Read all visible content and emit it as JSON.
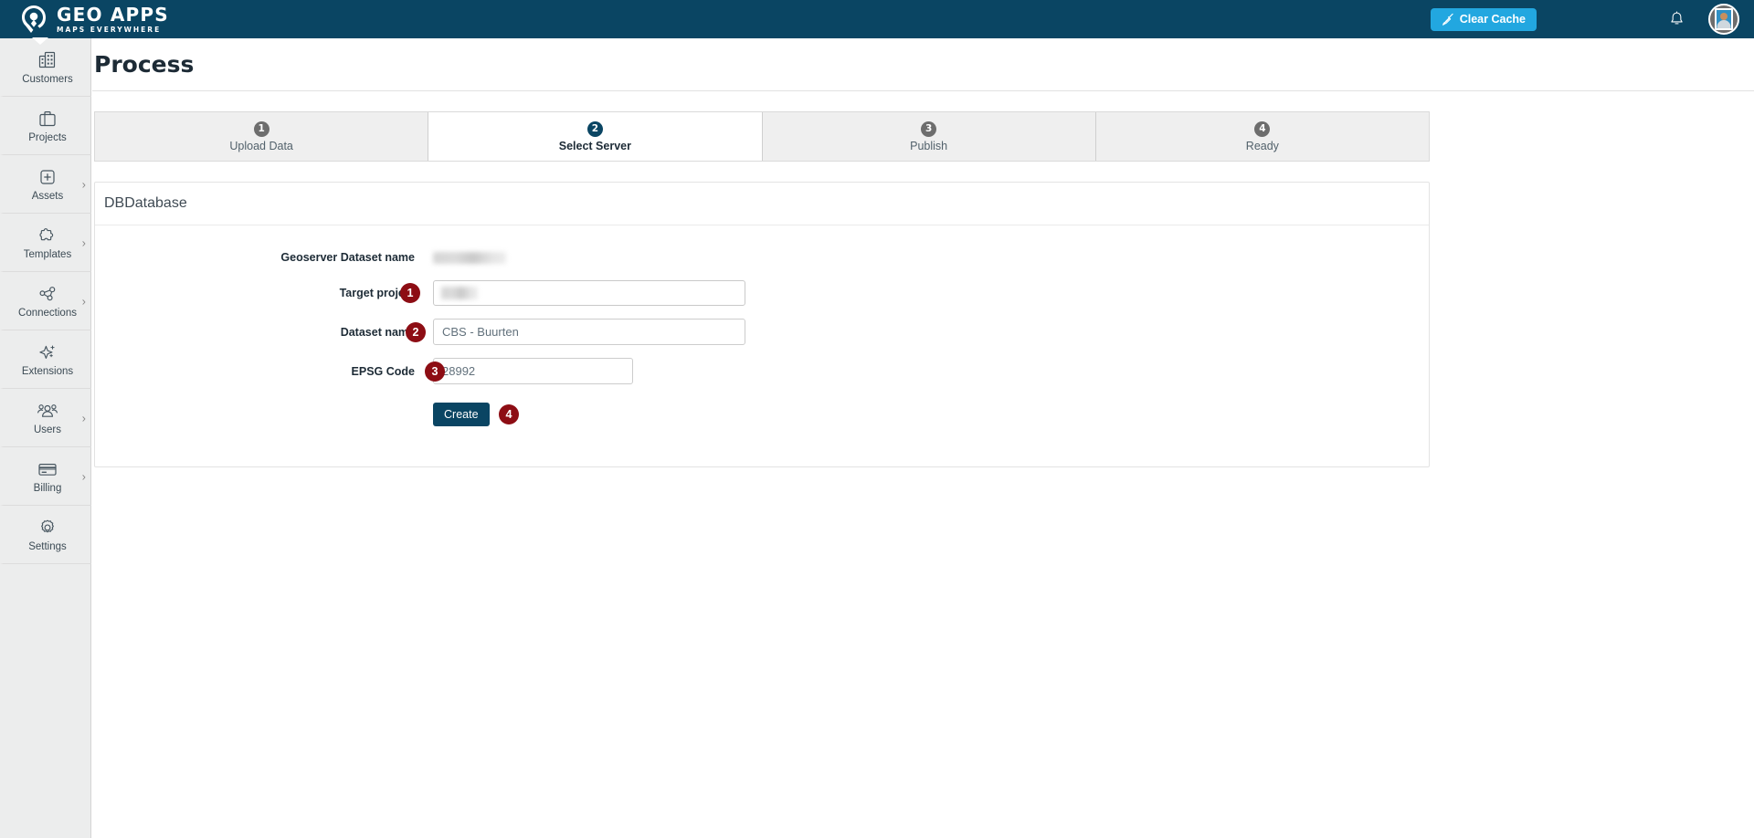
{
  "brand": {
    "title": "GEO APPS",
    "subtitle": "MAPS EVERYWHERE",
    "logo_icon": "map-pin-location-icon"
  },
  "topbar": {
    "clear_cache_label": "Clear Cache",
    "clear_cache_icon": "broom-icon",
    "clear_cache_color": "#22a7e0",
    "notifications_icon": "bell-icon",
    "avatar_icon": "user-photo-avatar",
    "background_color": "#0a4563"
  },
  "sidebar": {
    "items": [
      {
        "label": "Customers",
        "icon": "buildings-icon",
        "chevron": false
      },
      {
        "label": "Projects",
        "icon": "briefcase-icon",
        "chevron": false
      },
      {
        "label": "Assets",
        "icon": "plus-square-icon",
        "chevron": true
      },
      {
        "label": "Templates",
        "icon": "puzzle-icon",
        "chevron": true
      },
      {
        "label": "Connections",
        "icon": "share-nodes-icon",
        "chevron": true
      },
      {
        "label": "Extensions",
        "icon": "sparkle-icon",
        "chevron": false
      },
      {
        "label": "Users",
        "icon": "users-group-icon",
        "chevron": true
      },
      {
        "label": "Billing",
        "icon": "credit-card-icon",
        "chevron": true
      },
      {
        "label": "Settings",
        "icon": "gear-icon",
        "chevron": false
      }
    ],
    "chevron_glyph": "›"
  },
  "page": {
    "title": "Process"
  },
  "stepper": {
    "steps": [
      {
        "num": "1",
        "label": "Upload Data",
        "active": false
      },
      {
        "num": "2",
        "label": "Select Server",
        "active": true
      },
      {
        "num": "3",
        "label": "Publish",
        "active": false
      },
      {
        "num": "4",
        "label": "Ready",
        "active": false
      }
    ],
    "active_color": "#0a4563",
    "inactive_color": "#6d6d6d"
  },
  "card": {
    "title": "DBDatabase",
    "fields": {
      "geoserver_dataset_name": {
        "label": "Geoserver Dataset name",
        "value": "",
        "redacted": true
      },
      "target_project": {
        "badge": "1",
        "label": "Target project",
        "value": "",
        "redacted": true,
        "control": "select"
      },
      "dataset_name": {
        "badge": "2",
        "label": "Dataset name",
        "value": "CBS - Buurten",
        "placeholder": "CBS - Buurten",
        "control": "text"
      },
      "epsg_code": {
        "badge": "3",
        "label": "EPSG Code",
        "value": "28992",
        "placeholder": "28992",
        "control": "text"
      }
    },
    "submit": {
      "badge": "4",
      "label": "Create",
      "color": "#0a4563"
    }
  },
  "badge_color": "#8d0d14"
}
